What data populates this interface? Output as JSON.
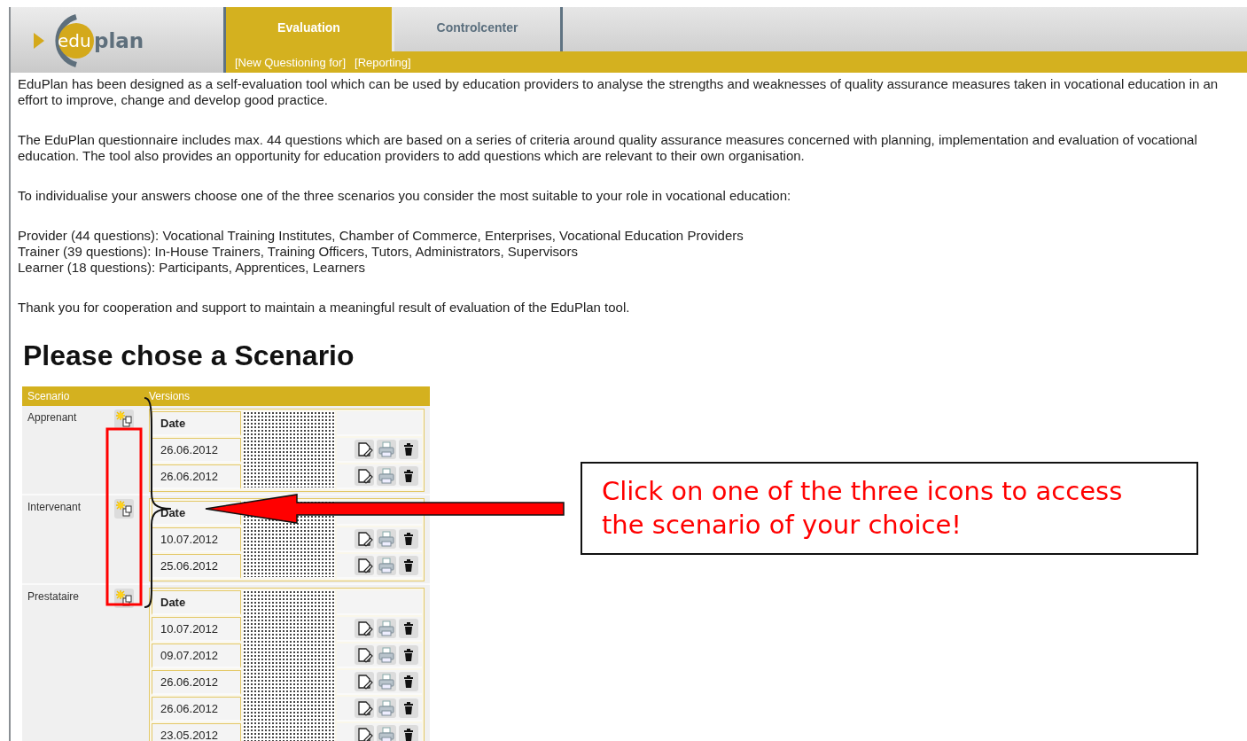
{
  "logo": {
    "parts": [
      "edu",
      "plan"
    ]
  },
  "tabs": [
    {
      "label": "Evaluation",
      "selected": true
    },
    {
      "label": "Controlcenter",
      "selected": false
    }
  ],
  "subnav": [
    "[New Questioning for]",
    "[Reporting]"
  ],
  "intro": [
    "EduPlan has been designed as a self-evaluation tool which can be used by education providers to analyse the strengths and weaknesses of quality assurance measures taken in vocational education in an effort to improve, change and develop good practice.",
    "The EduPlan questionnaire includes max. 44 questions which are based on a series of criteria around quality assurance measures concerned with planning, implementation and evaluation of vocational education. The tool also provides an opportunity for education providers to add questions which are relevant to their own organisation.",
    "To individualise your answers choose one of the three scenarios you consider the most suitable to your role in vocational education:"
  ],
  "scenario_lines": [
    "Provider (44 questions): Vocational Training Institutes, Chamber of Commerce, Enterprises, Vocational Education Providers",
    "Trainer (39 questions): In-House Trainers, Training Officers, Tutors, Administrators, Supervisors",
    "Learner (18 questions): Participants, Apprentices, Learners"
  ],
  "thanks": "Thank you for cooperation and support to maintain a meaningful result of evaluation of the EduPlan tool.",
  "heading": "Please chose a Scenario",
  "table": {
    "columns": [
      "Scenario",
      "Versions"
    ],
    "rows": [
      {
        "scenario": "Apprenant",
        "date_header": "Date",
        "versions": [
          "26.06.2012",
          "26.06.2012"
        ]
      },
      {
        "scenario": "Intervenant",
        "date_header": "Date",
        "versions": [
          "10.07.2012",
          "25.06.2012"
        ]
      },
      {
        "scenario": "Prestataire",
        "date_header": "Date",
        "versions": [
          "10.07.2012",
          "09.07.2012",
          "26.06.2012",
          "26.06.2012",
          "23.05.2012"
        ]
      }
    ]
  },
  "callout": "Click on one of the three icons to access the scenario of your choice!"
}
